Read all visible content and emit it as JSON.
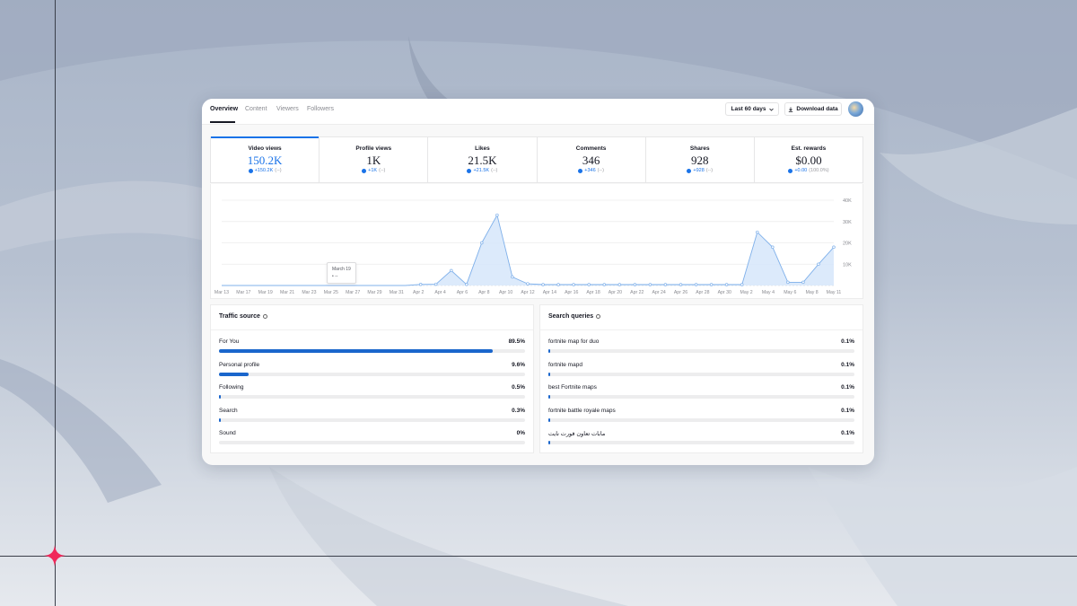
{
  "tabs": [
    "Overview",
    "Content",
    "Viewers",
    "Followers"
  ],
  "range_label": "Last 60 days",
  "download_label": "Download data",
  "metrics": [
    {
      "label": "Video views",
      "value": "150.2K",
      "delta": "+150.2K",
      "change": "(--)"
    },
    {
      "label": "Profile views",
      "value": "1K",
      "delta": "+1K",
      "change": "(--)"
    },
    {
      "label": "Likes",
      "value": "21.5K",
      "delta": "+21.5K",
      "change": "(--)"
    },
    {
      "label": "Comments",
      "value": "346",
      "delta": "+346",
      "change": "(--)"
    },
    {
      "label": "Shares",
      "value": "928",
      "delta": "+928",
      "change": "(--)"
    },
    {
      "label": "Est. rewards",
      "value": "$0.00",
      "delta": "+0.00",
      "change": "(100.0%)"
    }
  ],
  "chart_data": {
    "type": "area",
    "x": [
      "Mar 13",
      "Mar 15",
      "Mar 17",
      "Mar 19",
      "Mar 21",
      "Mar 23",
      "Mar 25",
      "Mar 27",
      "Mar 29",
      "Mar 31",
      "Apr 2",
      "Apr 4",
      "Apr 6",
      "Apr 8",
      "Apr 10",
      "Apr 12",
      "Apr 14",
      "Apr 16",
      "Apr 18",
      "Apr 20",
      "Apr 22",
      "Apr 24",
      "Apr 26",
      "Apr 28",
      "Apr 30",
      "May 2",
      "May 4",
      "May 6",
      "May 8",
      "May 11"
    ],
    "x_tick_labels": [
      "Mar 13",
      "Mar 17",
      "Mar 19",
      "Mar 21",
      "Mar 23",
      "Mar 25",
      "Mar 27",
      "Mar 29",
      "Mar 31",
      "Apr 2",
      "Apr 4",
      "Apr 6",
      "Apr 8",
      "Apr 10",
      "Apr 12",
      "Apr 14",
      "Apr 16",
      "Apr 18",
      "Apr 20",
      "Apr 22",
      "Apr 24",
      "Apr 26",
      "Apr 28",
      "Apr 30",
      "May 2",
      "May 4",
      "May 6",
      "May 8",
      "May 11"
    ],
    "values": [
      0,
      0,
      0,
      0,
      0,
      0,
      0,
      0,
      0,
      0,
      0,
      0,
      0,
      500,
      600,
      7000,
      500,
      20000,
      33000,
      4000,
      800,
      400,
      400,
      400,
      400,
      400,
      400,
      400,
      400,
      400,
      400,
      400,
      400,
      400,
      400,
      25000,
      18000,
      1500,
      1500,
      10000,
      18000
    ],
    "y_ticks": [
      "10K",
      "20K",
      "30K",
      "40K"
    ],
    "ylim": [
      0,
      40000
    ],
    "grid": true,
    "tooltip_title": "March 19",
    "tooltip_value": "• --"
  },
  "traffic": {
    "title": "Traffic source",
    "rows": [
      {
        "label": "For You",
        "value": "89.5%",
        "pct": 89.5
      },
      {
        "label": "Personal profile",
        "value": "9.6%",
        "pct": 9.6
      },
      {
        "label": "Following",
        "value": "0.5%",
        "pct": 0.5
      },
      {
        "label": "Search",
        "value": "0.3%",
        "pct": 0.3
      },
      {
        "label": "Sound",
        "value": "0%",
        "pct": 0
      }
    ]
  },
  "queries": {
    "title": "Search queries",
    "rows": [
      {
        "label": "fortnite map for duo",
        "value": "0.1%",
        "pct": 0.1
      },
      {
        "label": "fortnite mapd",
        "value": "0.1%",
        "pct": 0.1
      },
      {
        "label": "best Fortnite maps",
        "value": "0.1%",
        "pct": 0.1
      },
      {
        "label": "fortnite battle royale maps",
        "value": "0.1%",
        "pct": 0.1
      },
      {
        "label": "مابات تعاون فورت نايت",
        "value": "0.1%",
        "pct": 0.1
      }
    ]
  },
  "colors": {
    "accent": "#1a73e8",
    "bar": "#1a66cc",
    "star": "#f0285a"
  }
}
